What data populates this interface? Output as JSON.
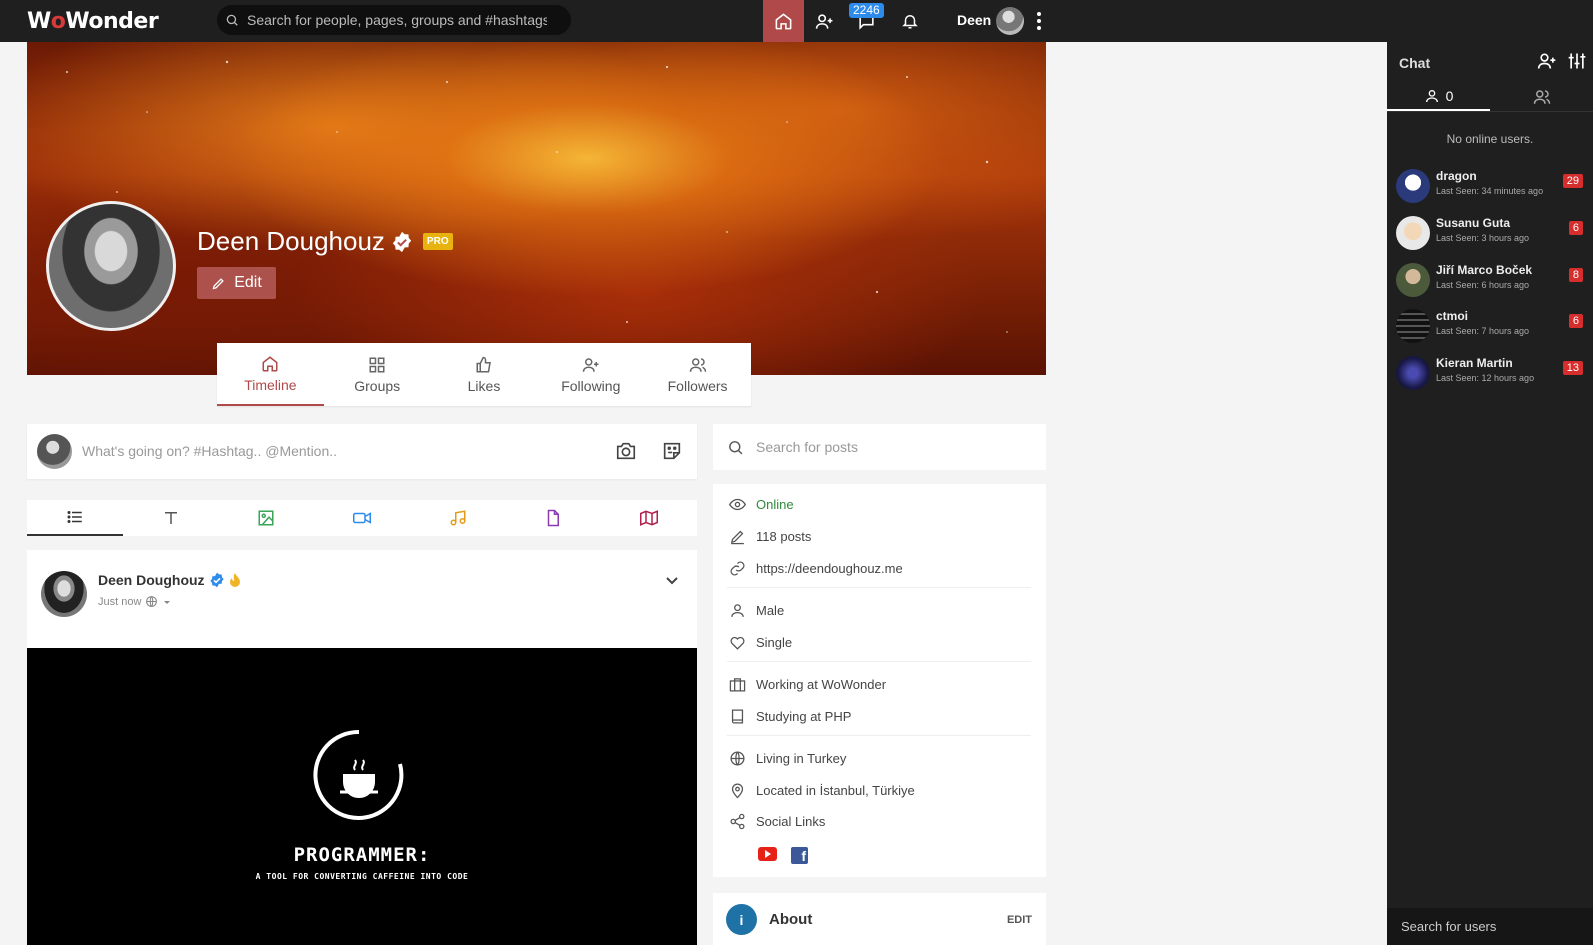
{
  "header": {
    "logo_prefix": "W",
    "logo_mid": "o",
    "logo_suffix": "Wonder",
    "search_placeholder": "Search for people, pages, groups and #hashtags",
    "messages_badge": "2246",
    "user_name": "Deen"
  },
  "profile": {
    "name": "Deen Doughouz",
    "pro_label": "PRO",
    "edit_label": "Edit",
    "tabs": [
      {
        "label": "Timeline",
        "icon": "home-icon"
      },
      {
        "label": "Groups",
        "icon": "grid-icon"
      },
      {
        "label": "Likes",
        "icon": "thumbs-up-icon"
      },
      {
        "label": "Following",
        "icon": "user-plus-icon"
      },
      {
        "label": "Followers",
        "icon": "users-icon"
      }
    ]
  },
  "publisher": {
    "placeholder": "What's going on? #Hashtag.. @Mention.."
  },
  "post": {
    "author": "Deen Doughouz",
    "time": "Just now",
    "image_title": "PROGRAMMER:",
    "image_subtitle": "A TOOL FOR CONVERTING CAFFEINE INTO CODE"
  },
  "post_search": {
    "placeholder": "Search for posts"
  },
  "info": {
    "status": "Online",
    "posts": "118 posts",
    "website": "https://deendoughouz.me",
    "gender": "Male",
    "relationship": "Single",
    "work": "Working at WoWonder",
    "study": "Studying at PHP",
    "living": "Living in Turkey",
    "located": "Located in İstanbul, Türkiye",
    "social": "Social Links"
  },
  "about": {
    "title": "About",
    "edit": "EDIT"
  },
  "chat": {
    "title": "Chat",
    "online_count": "0",
    "no_online": "No online users.",
    "users": [
      {
        "name": "dragon",
        "seen": "Last Seen: 34 minutes ago",
        "badge": "29"
      },
      {
        "name": "Susanu Guta",
        "seen": "Last Seen: 3 hours ago",
        "badge": "6"
      },
      {
        "name": "Jiří Marco Boček",
        "seen": "Last Seen: 6 hours ago",
        "badge": "8"
      },
      {
        "name": "ctmoi",
        "seen": "Last Seen: 7 hours ago",
        "badge": "6"
      },
      {
        "name": "Kieran Martin",
        "seen": "Last Seen: 12 hours ago",
        "badge": "13"
      }
    ],
    "search_placeholder": "Search for users"
  }
}
